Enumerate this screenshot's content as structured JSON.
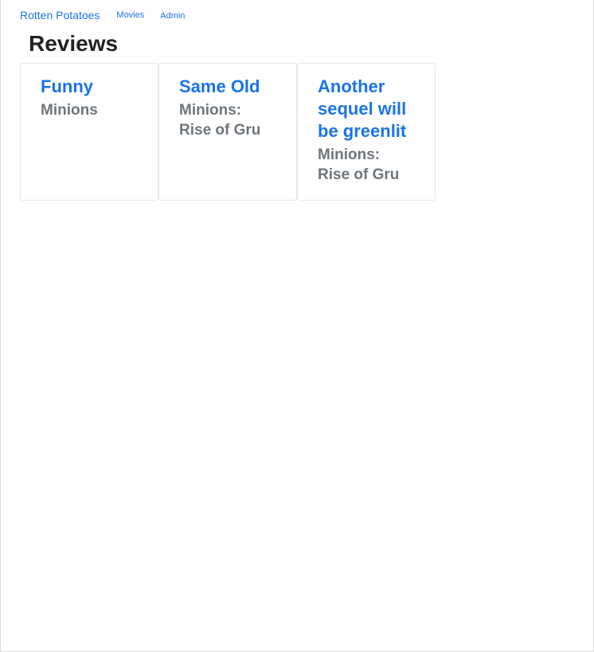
{
  "nav": {
    "brand": "Rotten Potatoes",
    "links": [
      "Movies",
      "Admin"
    ]
  },
  "page": {
    "title": "Reviews"
  },
  "reviews": [
    {
      "title": "Funny",
      "movie": "Minions"
    },
    {
      "title": "Same Old",
      "movie": "Minions: Rise of Gru"
    },
    {
      "title": "Another sequel will be greenlit",
      "movie": "Minions: Rise of Gru"
    }
  ],
  "colors": {
    "link": "#1a73e8",
    "heading": "#222222",
    "muted": "#6f757c",
    "card_border": "#e6e6e6"
  }
}
